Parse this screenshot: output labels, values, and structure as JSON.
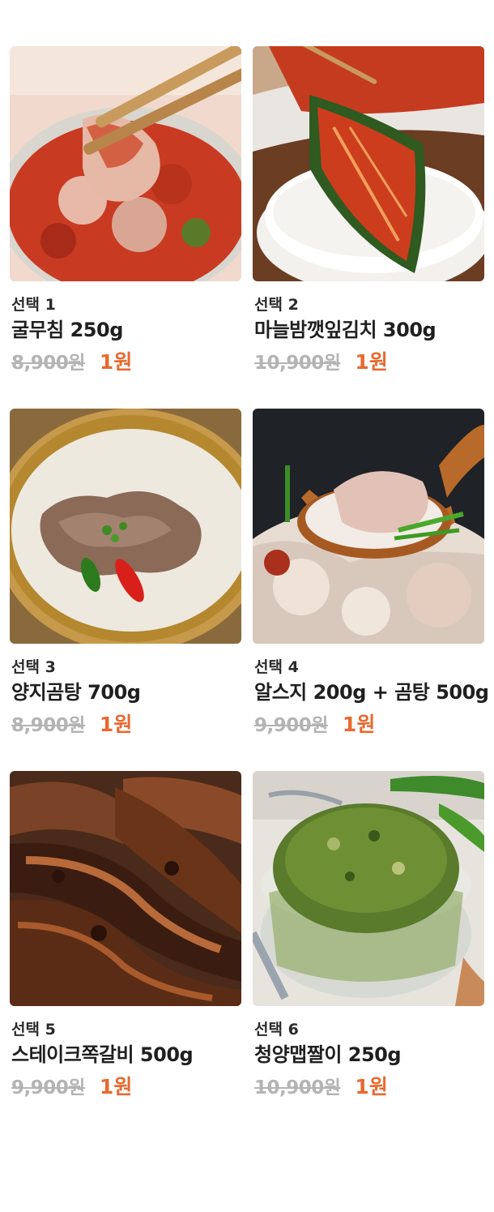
{
  "products": [
    {
      "select": "선택 1",
      "name": "굴무침 250g",
      "original_price": "8,900원",
      "sale_price": "1원",
      "image": "oyster-kimchi-photo"
    },
    {
      "select": "선택 2",
      "name": "마늘밤깻잎김치 300g",
      "original_price": "10,900원",
      "sale_price": "1원",
      "image": "perilla-kimchi-rice-photo"
    },
    {
      "select": "선택 3",
      "name": "양지곰탕 700g",
      "original_price": "8,900원",
      "sale_price": "1원",
      "image": "brisket-gomtang-photo"
    },
    {
      "select": "선택 4",
      "name": "알스지 200g + 곰탕 500g",
      "original_price": "9,900원",
      "sale_price": "1원",
      "image": "beef-tendon-soup-photo"
    },
    {
      "select": "선택 5",
      "name": "스테이크쪽갈비 500g",
      "original_price": "9,900원",
      "sale_price": "1원",
      "image": "grilled-ribs-photo"
    },
    {
      "select": "선택 6",
      "name": "청양맵짤이 250g",
      "original_price": "10,900원",
      "sale_price": "1원",
      "image": "chili-anchovy-relish-photo"
    }
  ],
  "colors": {
    "sale": "#e8692f",
    "original": "#b4b4b4",
    "text": "#1f1f1f"
  }
}
